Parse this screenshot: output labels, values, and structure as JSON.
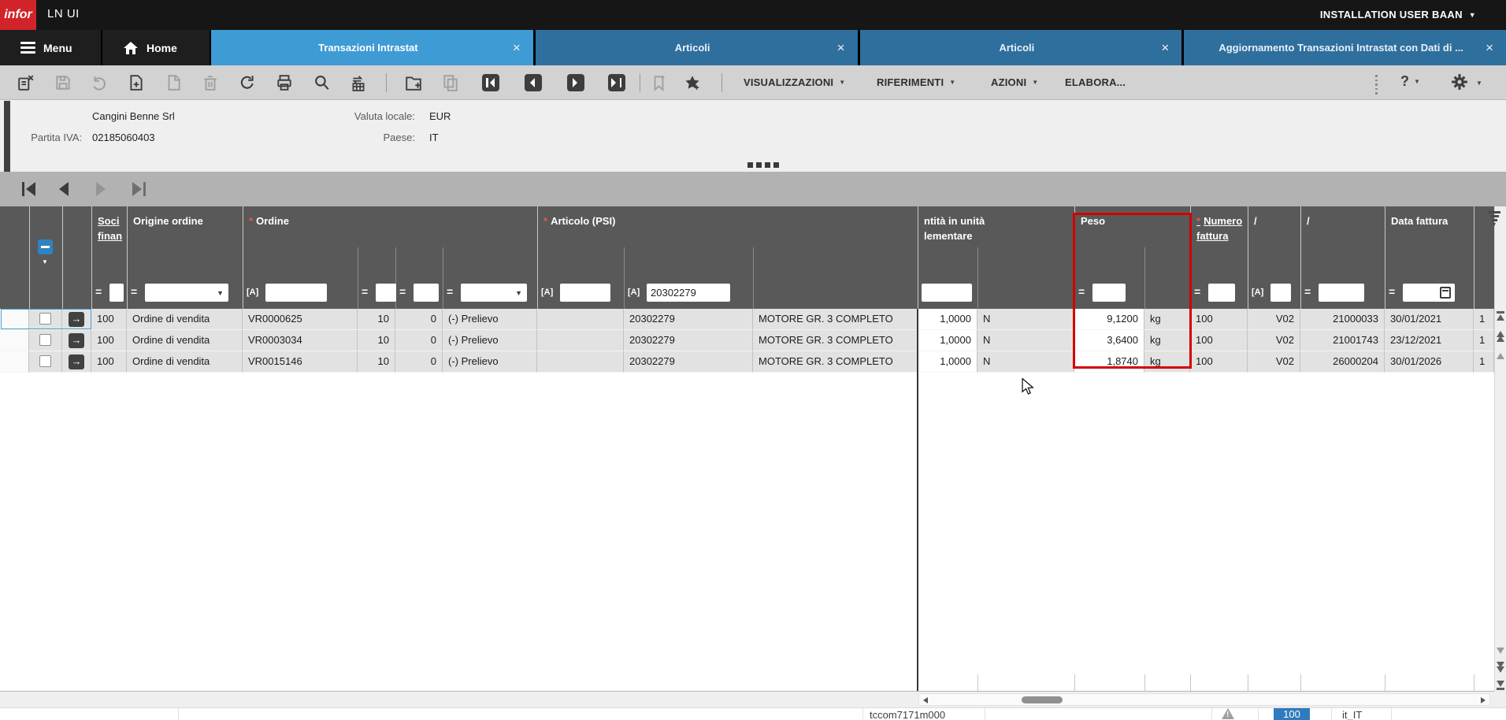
{
  "topbar": {
    "logo": "infor",
    "app_title": "LN UI",
    "user_menu": "INSTALLATION USER BAAN"
  },
  "tabbar": {
    "menu_label": "Menu",
    "home_label": "Home",
    "tabs": [
      {
        "label": "Transazioni Intrastat",
        "active": true,
        "close": "×"
      },
      {
        "label": "Articoli",
        "active": false,
        "close": "×"
      },
      {
        "label": "Articoli",
        "active": false,
        "close": "×"
      },
      {
        "label": "Aggiornamento Transazioni Intrastat con Dati di ...",
        "active": false,
        "close": "×"
      }
    ]
  },
  "toolbar": {
    "menus": [
      "VISUALIZZAZIONI",
      "RIFERIMENTI",
      "AZIONI",
      "ELABORA..."
    ],
    "help_label": "?"
  },
  "info_panel": {
    "company_name": "Cangini Benne Srl",
    "partita_iva_label": "Partita IVA:",
    "partita_iva": "02185060403",
    "valuta_label": "Valuta locale:",
    "valuta": "EUR",
    "paese_label": "Paese:",
    "paese": "IT"
  },
  "grid": {
    "operators": {
      "eq": "=",
      "like": "[A]"
    },
    "header": {
      "soci": "Soci\nfinan",
      "origine": "Origine ordine",
      "ordine": "Ordine",
      "articolo": "Articolo (PSI)",
      "quantita": "ntità in unità\nlementare",
      "peso": "Peso",
      "numero_fattura": "Numero\nfattura",
      "slash1": "/",
      "slash2": "/",
      "data_fattura": "Data fattura",
      "trunc": ""
    },
    "filter_values": {
      "art2": "20302279"
    },
    "rows": [
      {
        "soci": "100",
        "origine": "Ordine di vendita",
        "ordno": "VR0000625",
        "line": "10",
        "seq": "0",
        "kind": "(-) Prelievo",
        "art1": "",
        "art2": "20302279",
        "artdesc": "MOTORE GR. 3 COMPLETO",
        "qty": "1,0000",
        "qflag": "N",
        "peso": "9,1200",
        "unit": "kg",
        "numfat": "100",
        "slash1": "V02",
        "slash2": "21000033",
        "datafat": "30/01/2021",
        "trunc": "1"
      },
      {
        "soci": "100",
        "origine": "Ordine di vendita",
        "ordno": "VR0003034",
        "line": "10",
        "seq": "0",
        "kind": "(-) Prelievo",
        "art1": "",
        "art2": "20302279",
        "artdesc": "MOTORE GR. 3 COMPLETO",
        "qty": "1,0000",
        "qflag": "N",
        "peso": "3,6400",
        "unit": "kg",
        "numfat": "100",
        "slash1": "V02",
        "slash2": "21001743",
        "datafat": "23/12/2021",
        "trunc": "1"
      },
      {
        "soci": "100",
        "origine": "Ordine di vendita",
        "ordno": "VR0015146",
        "line": "10",
        "seq": "0",
        "kind": "(-) Prelievo",
        "art1": "",
        "art2": "20302279",
        "artdesc": "MOTORE GR. 3 COMPLETO",
        "qty": "1,0000",
        "qflag": "N",
        "peso": "1,8740",
        "unit": "kg",
        "numfat": "100",
        "slash1": "V02",
        "slash2": "26000204",
        "datafat": "30/01/2026",
        "trunc": "1"
      }
    ],
    "colors": {
      "highlight_red": "#d40000",
      "header_bg": "#595959",
      "active_tab": "#3e9bd4",
      "inactive_tab": "#2f6f9e",
      "badge_blue": "#2e7bbf"
    }
  },
  "statusbar": {
    "program": "tccom7171m000",
    "company": "100",
    "locale": "it_IT"
  }
}
